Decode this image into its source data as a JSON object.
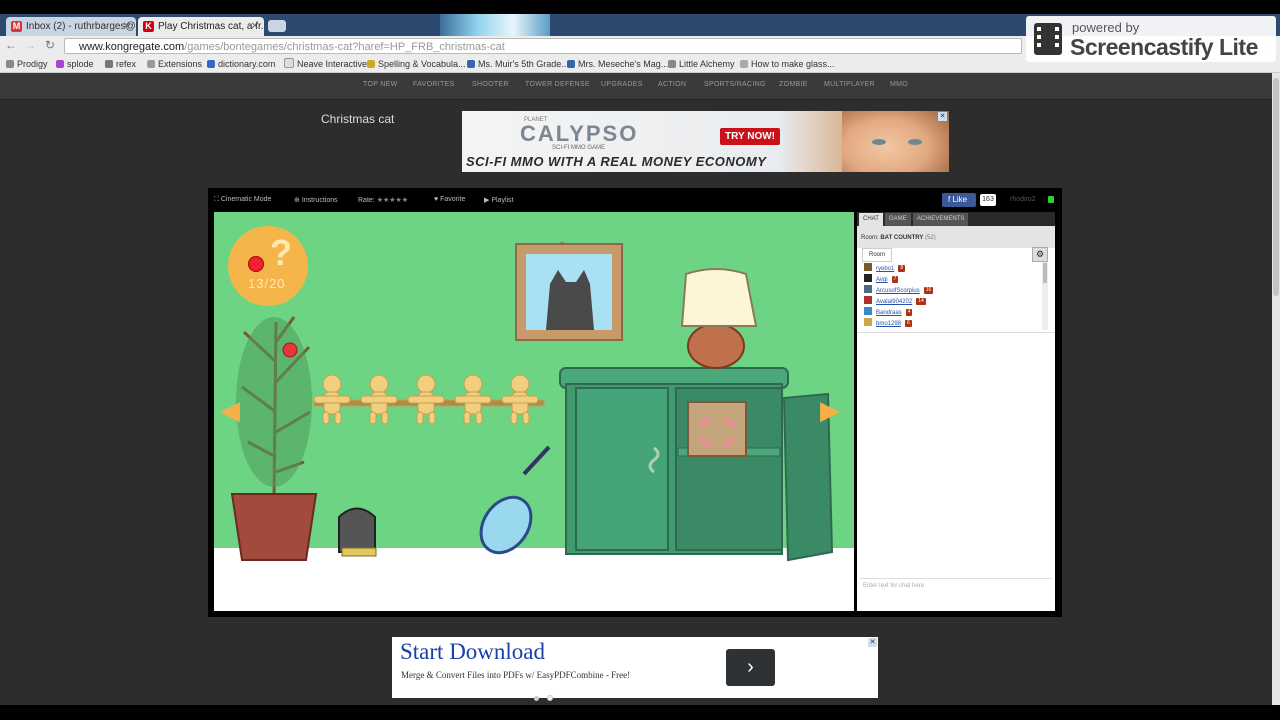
{
  "browser": {
    "tabs": [
      {
        "label": "Inbox (2) - ruthrbarges@...",
        "active": false
      },
      {
        "label": "Play Christmas cat, a fr...",
        "active": true
      }
    ],
    "url_host": "www.kongregate.com",
    "url_path": "/games/bontegames/christmas-cat?haref=HP_FRB_christmas-cat",
    "bookmarks": [
      "Prodigy",
      "splode",
      "refex",
      "Extensions",
      "dictionary.com",
      "Neave Interactive",
      "Spelling & Vocabula...",
      "Ms. Muir's 5th Grade...",
      "Mrs. Meseche's Mag...",
      "Little Alchemy",
      "How to make glass..."
    ]
  },
  "screencastify": {
    "line1": "powered by",
    "line2": "Screencastify Lite"
  },
  "site_nav": [
    "TOP NEW",
    "FAVORITES",
    "SHOOTER",
    "TOWER DEFENSE",
    "UPGRADES",
    "ACTION",
    "SPORTS/RACING",
    "ZOMBIE",
    "MULTIPLAYER",
    "MMO"
  ],
  "game_title": "Christmas cat",
  "ad_top": {
    "planet": "PLANET",
    "brand": "CALYPSO",
    "subtitle": "SCI-FI MMO GAME",
    "cta": "TRY NOW!",
    "tagline": "SCI-FI MMO WITH A REAL MONEY ECONOMY"
  },
  "game_bar": {
    "cinematic": "Cinematic Mode",
    "instructions": "Instructions",
    "rate": "Rate:",
    "stars": "★★★★★",
    "favorite": "Favorite",
    "playlist": "Playlist",
    "fb_like": "Like",
    "fb_count": "163",
    "user": "rhodiro2"
  },
  "game": {
    "counter": "13/20",
    "hint_glyph": "?",
    "left_arrow": "◀",
    "right_arrow": "▶"
  },
  "chat": {
    "tabs": [
      "CHAT",
      "GAME",
      "ACHIEVEMENTS"
    ],
    "room_label": "Room:",
    "room_name": "BAT COUNTRY",
    "room_count": "(52)",
    "room_tab": "Room",
    "users": [
      {
        "name": "ryebo1",
        "level": "8",
        "color": "#7a5a2a"
      },
      {
        "name": "Avgi",
        "level": "7",
        "color": "#222222"
      },
      {
        "name": "ArcusofScorpius",
        "level": "16",
        "color": "#4a6a8a"
      },
      {
        "name": "Avalai904202",
        "level": "14",
        "color": "#b03030"
      },
      {
        "name": "Bandraas",
        "level": "4",
        "color": "#3a8ac8"
      },
      {
        "name": "bmo1298",
        "level": "6",
        "color": "#c8a848"
      }
    ],
    "input_placeholder": "Enter text for chat here"
  },
  "ad_bottom": {
    "headline": "Start Download",
    "subtext": "Merge & Convert Files into PDFs w/ EasyPDFCombine - Free!",
    "cta_glyph": "›"
  }
}
